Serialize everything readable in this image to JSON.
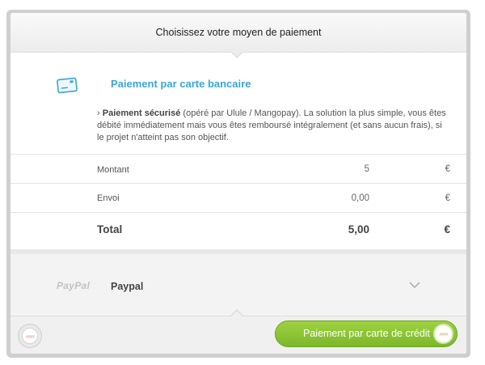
{
  "header": {
    "title": "Choisissez votre moyen de paiement"
  },
  "card_payment": {
    "title": "Paiement par carte bancaire",
    "desc_bold": "Paiement sécurisé",
    "desc_rest": " (opéré par Ulule / Mangopay). La solution la plus simple, vous êtes débité immédiatement mais vous êtes remboursé intégralement (et sans aucun frais), si le projet n'atteint pas son objectif.",
    "bullet": "›"
  },
  "summary": {
    "rows": [
      {
        "label": "Montant",
        "value": "5",
        "currency": "€"
      },
      {
        "label": "Envoi",
        "value": "0,00",
        "currency": "€"
      }
    ],
    "total": {
      "label": "Total",
      "value": "5,00",
      "currency": "€"
    }
  },
  "paypal": {
    "logo_text": "PayPal",
    "label": "Paypal"
  },
  "footer": {
    "back_icon": "«««",
    "pay_button_label": "Paiement par carte de crédit",
    "pay_button_icon": "»»»"
  },
  "colors": {
    "accent_blue": "#3aa5d8",
    "button_green": "#8cc534"
  }
}
